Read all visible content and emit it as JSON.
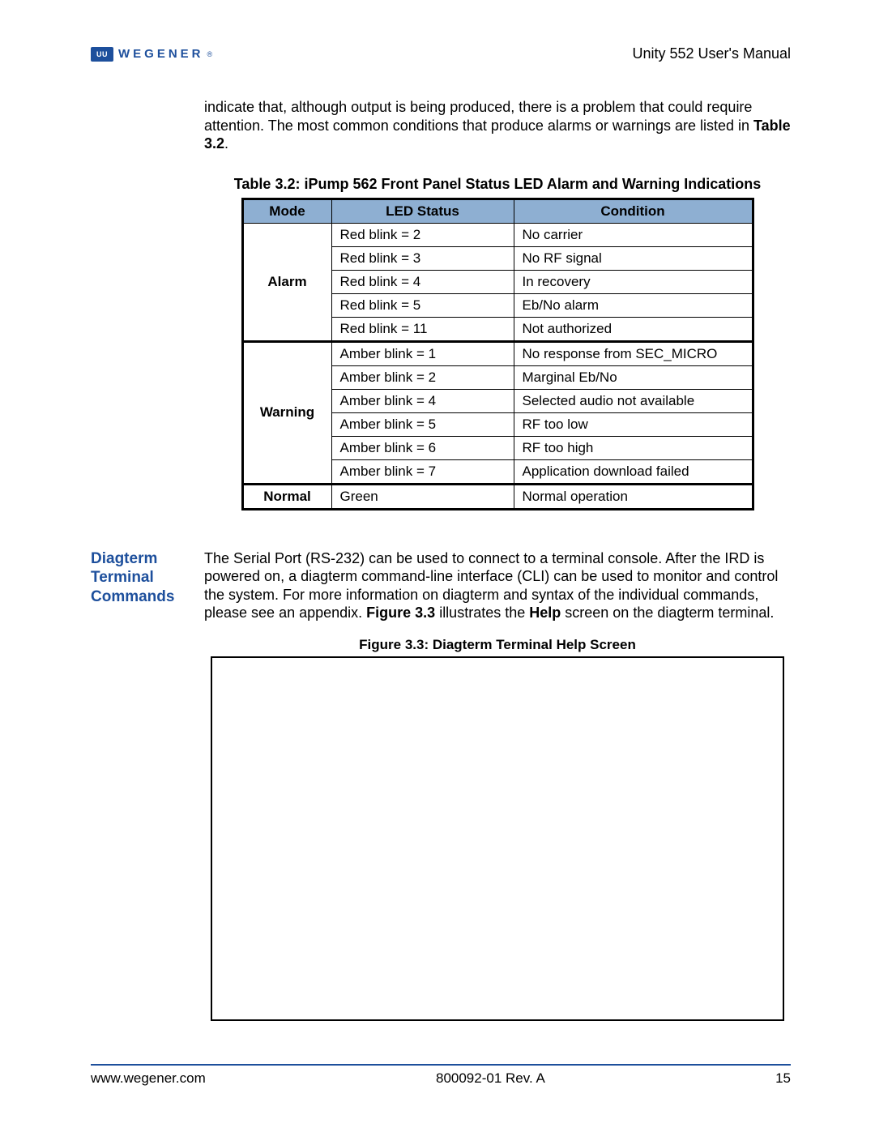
{
  "header": {
    "logo_box_text": "UU",
    "logo_text": "WEGENER",
    "logo_reg": "®",
    "doc_title": "Unity 552 User's Manual"
  },
  "intro": {
    "line1": "indicate that, although output is being produced, there is a problem that could require attention. The most common conditions that produce alarms or warnings are listed in ",
    "bold1": "Table 3.2",
    "tail": "."
  },
  "table": {
    "caption": "Table 3.2: iPump 562 Front Panel Status LED Alarm and Warning Indications",
    "headers": {
      "mode": "Mode",
      "led": "LED Status",
      "cond": "Condition"
    },
    "groups": [
      {
        "mode": "Alarm",
        "rows": [
          {
            "led": "Red blink = 2",
            "cond": "No carrier"
          },
          {
            "led": "Red blink = 3",
            "cond": "No RF signal"
          },
          {
            "led": "Red blink = 4",
            "cond": "In recovery"
          },
          {
            "led": "Red blink = 5",
            "cond": "Eb/No alarm"
          },
          {
            "led": "Red blink = 11",
            "cond": "Not authorized"
          }
        ]
      },
      {
        "mode": "Warning",
        "rows": [
          {
            "led": "Amber blink = 1",
            "cond": "No response from SEC_MICRO"
          },
          {
            "led": "Amber blink = 2",
            "cond": "Marginal Eb/No"
          },
          {
            "led": "Amber blink = 4",
            "cond": "Selected audio not available"
          },
          {
            "led": "Amber blink = 5",
            "cond": "RF too low"
          },
          {
            "led": "Amber blink = 6",
            "cond": "RF too high"
          },
          {
            "led": "Amber blink = 7",
            "cond": "Application download failed"
          }
        ]
      },
      {
        "mode": "Normal",
        "rows": [
          {
            "led": "Green",
            "cond": "Normal operation"
          }
        ]
      }
    ]
  },
  "section": {
    "label_l1": "Diagterm",
    "label_l2": "Terminal",
    "label_l3": "Commands",
    "body_pre": "The Serial Port (RS-232) can be used to connect to a terminal console. After the IRD is powered on, a diagterm command-line interface (CLI) can be used to monitor and control the system. For more information on diagterm and syntax of the individual commands, please see an appendix. ",
    "body_bold1": "Figure 3.3",
    "body_mid": " illustrates the ",
    "body_bold2": "Help",
    "body_tail": " screen on the diagterm terminal."
  },
  "figure": {
    "caption": "Figure 3.3:   Diagterm Terminal Help Screen"
  },
  "footer": {
    "left": "www.wegener.com",
    "center": "800092-01 Rev. A",
    "right": "15"
  }
}
